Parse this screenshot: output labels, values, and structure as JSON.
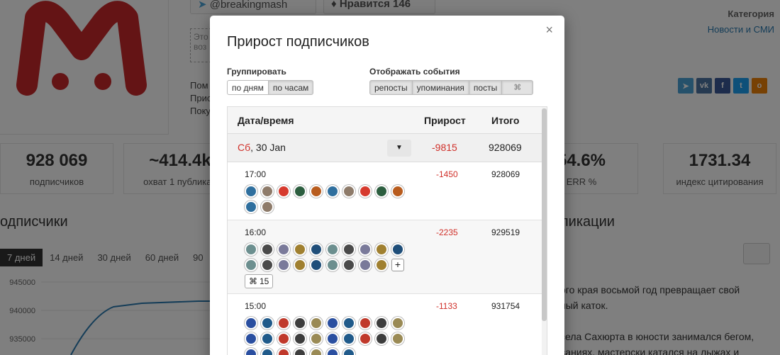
{
  "background": {
    "channel_handle": "@breakingmash",
    "likes_label": "Нравится",
    "likes_count": "146",
    "description_placeholder": "Это воз",
    "side_lines": [
      "Пом",
      "Прис",
      "Поку"
    ],
    "category_label": "Категория",
    "category_value": "Новости и СМИ",
    "stats": [
      {
        "num": "928 069",
        "label": "подписчиков"
      },
      {
        "num": "~414.4k",
        "label": "охват 1 публикац"
      },
      {
        "num": "54.6%",
        "label": "ERR %"
      },
      {
        "num": "1731.34",
        "label": "индекс цитирования"
      }
    ],
    "section_left": "одписчики",
    "section_right": "ликации",
    "ranges": [
      "7 дней",
      "14 дней",
      "30 дней",
      "60 дней",
      "90"
    ],
    "chart_ticks": [
      "945000",
      "940000",
      "935000"
    ],
    "post_lines": [
      "ого края восьмой год превращает свой",
      "ный каток.",
      "",
      "села Сахюрта в юности занимался бегом,",
      "ваниях, мастерски катался на лыжах и"
    ],
    "social_colors": [
      "#4aa3d6",
      "#4c75a3",
      "#3b5998",
      "#1da1f2",
      "#ee8208"
    ]
  },
  "modal": {
    "title": "Прирост подписчиков",
    "close": "×",
    "group_label": "Группировать",
    "group_buttons": [
      "по дням",
      "по часам"
    ],
    "events_label": "Отображать события",
    "event_buttons": [
      "репосты",
      "упоминания",
      "посты"
    ],
    "table": {
      "col_date": "Дата/время",
      "col_gain": "Прирост",
      "col_total": "Итого",
      "day": {
        "dow": "Сб",
        "date": ", 30 Jan",
        "gain": "-9815",
        "total": "928069"
      },
      "hours": [
        {
          "time": "17:00",
          "gain": "-1450",
          "total": "928069",
          "avatar_count": 12
        },
        {
          "time": "16:00",
          "gain": "-2235",
          "total": "929519",
          "avatar_count": 19,
          "more_count": "15"
        },
        {
          "time": "15:00",
          "gain": "-1133",
          "total": "931754",
          "avatar_count": 27
        }
      ]
    }
  }
}
